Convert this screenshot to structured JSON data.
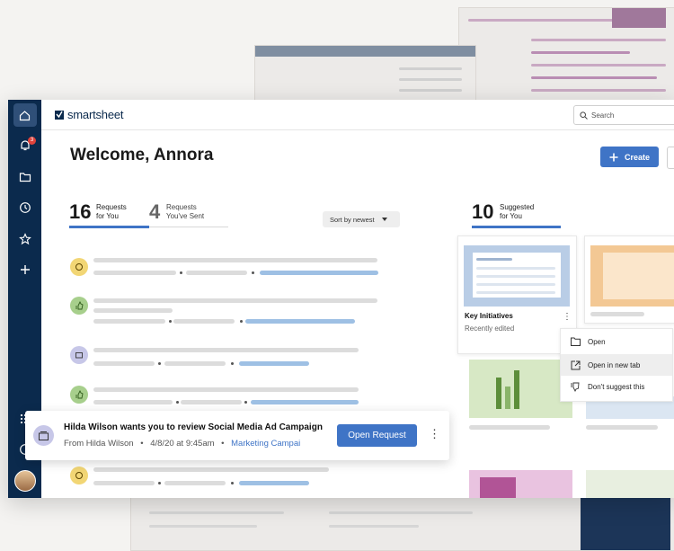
{
  "brand": {
    "name": "smartsheet",
    "accent": "#3f74c6",
    "nav_bg": "#0b2a4d"
  },
  "nav": {
    "notification_count": "3"
  },
  "search": {
    "placeholder": "Search"
  },
  "header": {
    "welcome": "Welcome, Annora",
    "create_label": "Create"
  },
  "stats": {
    "requests_for_you": {
      "count": "16",
      "line1": "Requests",
      "line2": "for You"
    },
    "requests_sent": {
      "count": "4",
      "line1": "Requests",
      "line2": "You've Sent"
    },
    "suggested": {
      "count": "10",
      "line1": "Suggested",
      "line2": "for You"
    }
  },
  "sort": {
    "label": "Sort by newest"
  },
  "suggested_card": {
    "title": "Key Initiatives",
    "subtitle": "Recently edited"
  },
  "context_menu": {
    "items": [
      "Open",
      "Open in new tab",
      "Don't suggest this"
    ]
  },
  "notification": {
    "title": "Hilda Wilson wants you to review Social Media Ad Campaign",
    "from": "From Hilda Wilson",
    "date": "4/8/20 at 9:45am",
    "link": "Marketing Campai",
    "button": "Open Request"
  },
  "icons": [
    "home-icon",
    "bell-icon",
    "folder-icon",
    "clock-icon",
    "star-icon",
    "plus-icon",
    "apps-icon",
    "help-icon",
    "search-icon",
    "flag-icon"
  ]
}
